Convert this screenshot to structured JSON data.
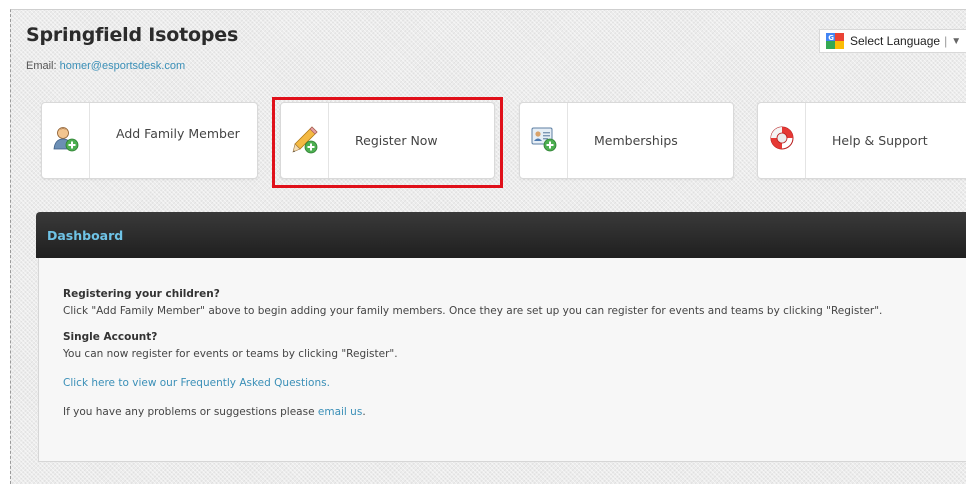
{
  "header": {
    "org_name": "Springfield Isotopes",
    "email_label": "Email:",
    "email": "homer@esportsdesk.com"
  },
  "language": {
    "label": "Select Language",
    "separator": "|",
    "arrow": "▼"
  },
  "tiles": [
    {
      "label": "Add Family Member",
      "icon": "add-family-member-icon"
    },
    {
      "label": "Register Now",
      "icon": "pencil-add-icon"
    },
    {
      "label": "Memberships",
      "icon": "membership-card-add-icon"
    },
    {
      "label": "Help & Support",
      "icon": "lifebuoy-icon"
    }
  ],
  "dashboard": {
    "title": "Dashboard",
    "q1": "Registering your children?",
    "p1": "Click \"Add Family Member\" above to begin adding your family members. Once they are set up you can register for events and teams by clicking \"Register\".",
    "q2": "Single Account?",
    "p2": "You can now register for events or teams by clicking \"Register\".",
    "faq_link": "Click here to view our Frequently Asked Questions.",
    "contact_prefix": "If you have any problems or suggestions please ",
    "contact_link": "email us",
    "contact_suffix": "."
  },
  "colors": {
    "link": "#3a8fb7",
    "dashboard_title": "#6fc3e6",
    "highlight": "#e0101a"
  }
}
